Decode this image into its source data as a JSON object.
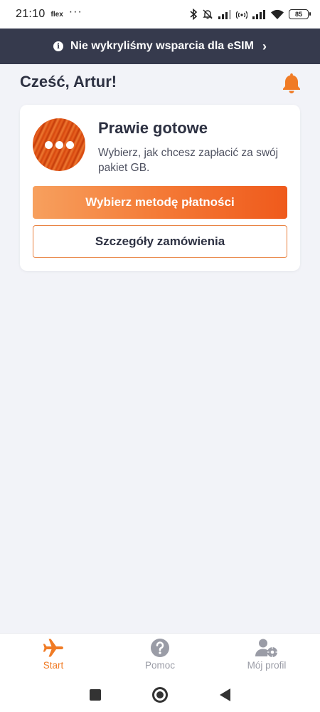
{
  "status_bar": {
    "time": "21:10",
    "carrier": "flex",
    "dots": "···",
    "battery": "85"
  },
  "esim_banner": {
    "text": "Nie wykryliśmy wsparcia dla eSIM",
    "info_icon": "i",
    "chevron": "›"
  },
  "greeting": "Cześć, Artur!",
  "card": {
    "title": "Prawie gotowe",
    "description": "Wybierz, jak chcesz zapłacić za swój pakiet GB.",
    "primary_button": "Wybierz metodę płatności",
    "secondary_button": "Szczegóły zamówienia"
  },
  "bottom_nav": {
    "items": [
      {
        "label": "Start",
        "icon": "airplane-icon",
        "active": true
      },
      {
        "label": "Pomoc",
        "icon": "help-icon",
        "active": false
      },
      {
        "label": "Mój profil",
        "icon": "user-settings-icon",
        "active": false
      }
    ]
  },
  "colors": {
    "accent": "#f07b25",
    "banner": "#363a4d",
    "background": "#f2f3f8"
  }
}
